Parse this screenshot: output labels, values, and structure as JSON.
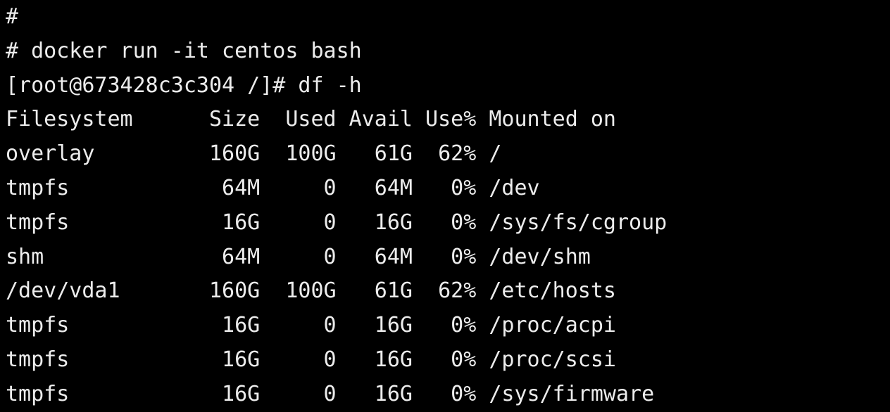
{
  "lines": {
    "l0": "#",
    "l1": "# docker run -it centos bash",
    "l2": "[root@673428c3c304 /]# df -h",
    "header": "Filesystem      Size  Used Avail Use% Mounted on",
    "r0": "overlay         160G  100G   61G  62% /",
    "r1": "tmpfs            64M     0   64M   0% /dev",
    "r2": "tmpfs            16G     0   16G   0% /sys/fs/cgroup",
    "r3": "shm              64M     0   64M   0% /dev/shm",
    "r4": "/dev/vda1       160G  100G   61G  62% /etc/hosts",
    "r5": "tmpfs            16G     0   16G   0% /proc/acpi",
    "r6": "tmpfs            16G     0   16G   0% /proc/scsi",
    "r7": "tmpfs            16G     0   16G   0% /sys/firmware"
  },
  "df_rows": [
    {
      "filesystem": "overlay",
      "size": "160G",
      "used": "100G",
      "avail": "61G",
      "use_pct": "62%",
      "mounted_on": "/"
    },
    {
      "filesystem": "tmpfs",
      "size": "64M",
      "used": "0",
      "avail": "64M",
      "use_pct": "0%",
      "mounted_on": "/dev"
    },
    {
      "filesystem": "tmpfs",
      "size": "16G",
      "used": "0",
      "avail": "16G",
      "use_pct": "0%",
      "mounted_on": "/sys/fs/cgroup"
    },
    {
      "filesystem": "shm",
      "size": "64M",
      "used": "0",
      "avail": "64M",
      "use_pct": "0%",
      "mounted_on": "/dev/shm"
    },
    {
      "filesystem": "/dev/vda1",
      "size": "160G",
      "used": "100G",
      "avail": "61G",
      "use_pct": "62%",
      "mounted_on": "/etc/hosts"
    },
    {
      "filesystem": "tmpfs",
      "size": "16G",
      "used": "0",
      "avail": "16G",
      "use_pct": "0%",
      "mounted_on": "/proc/acpi"
    },
    {
      "filesystem": "tmpfs",
      "size": "16G",
      "used": "0",
      "avail": "16G",
      "use_pct": "0%",
      "mounted_on": "/proc/scsi"
    },
    {
      "filesystem": "tmpfs",
      "size": "16G",
      "used": "0",
      "avail": "16G",
      "use_pct": "0%",
      "mounted_on": "/sys/firmware"
    }
  ]
}
